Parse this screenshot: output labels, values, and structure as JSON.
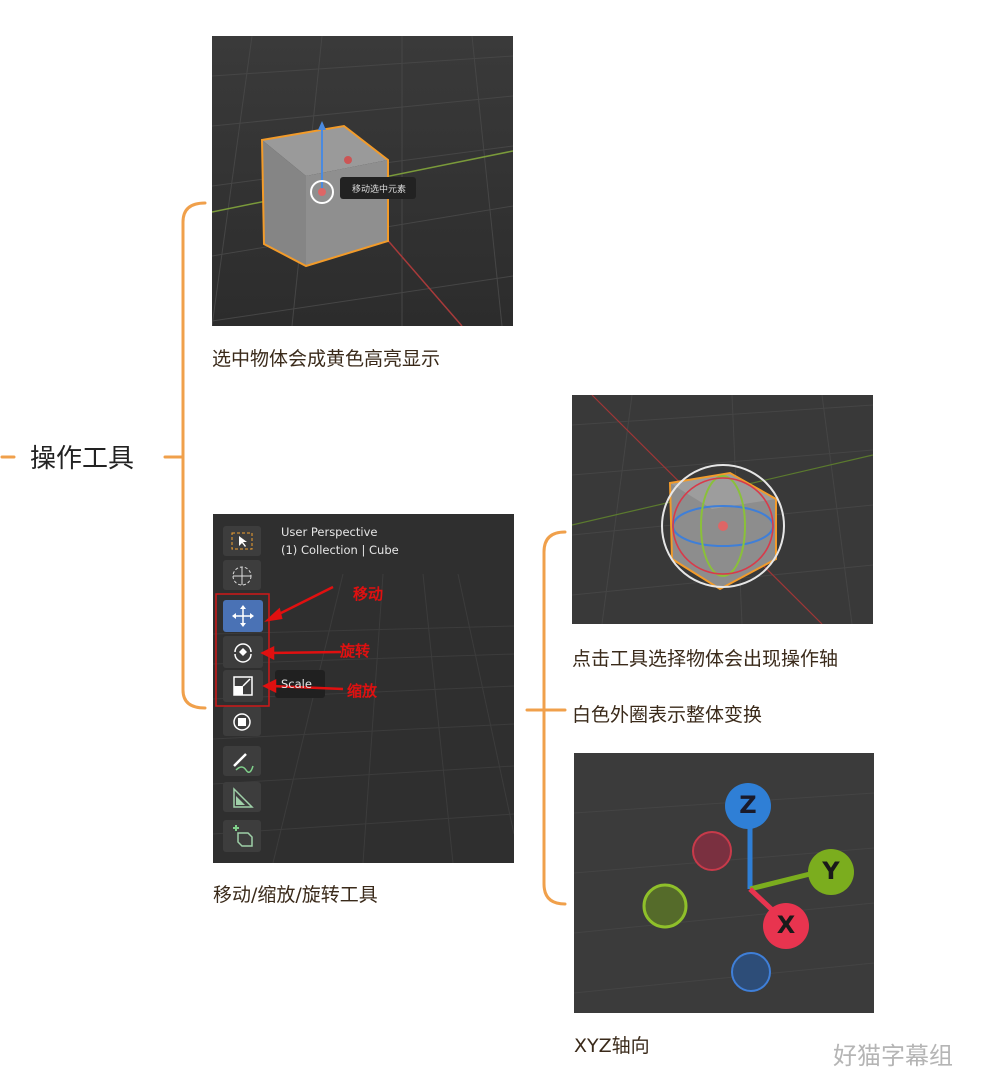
{
  "root": {
    "label": "操作工具"
  },
  "nodes": [
    {
      "caption": "选中物体会成黄色高亮显示",
      "tooltip": "移动选中元素"
    },
    {
      "caption": "移动/缩放/旋转工具",
      "viewport_title": "User Perspective",
      "viewport_subtitle": "(1) Collection | Cube",
      "tool_tooltip": "Scale",
      "annotations": [
        "移动",
        "旋转",
        "缩放"
      ],
      "tools": [
        "select-box-icon",
        "cursor-icon",
        "move-icon",
        "rotate-icon",
        "scale-icon",
        "transform-icon",
        "annotate-icon",
        "measure-icon",
        "add-cube-icon"
      ]
    }
  ],
  "sub": [
    {
      "caption": "点击工具选择物体会出现操作轴"
    },
    {
      "caption": "白色外圈表示整体变换"
    },
    {
      "caption": "XYZ轴向",
      "axes": [
        "Z",
        "Y",
        "X"
      ]
    }
  ],
  "watermark": "好猫字幕组",
  "colors": {
    "bracket": "#f0a04b",
    "highlight": "#f29b2a",
    "x": "#e8344f",
    "y": "#7bad1e",
    "z": "#2f7fd6",
    "annotation": "#e01010"
  }
}
